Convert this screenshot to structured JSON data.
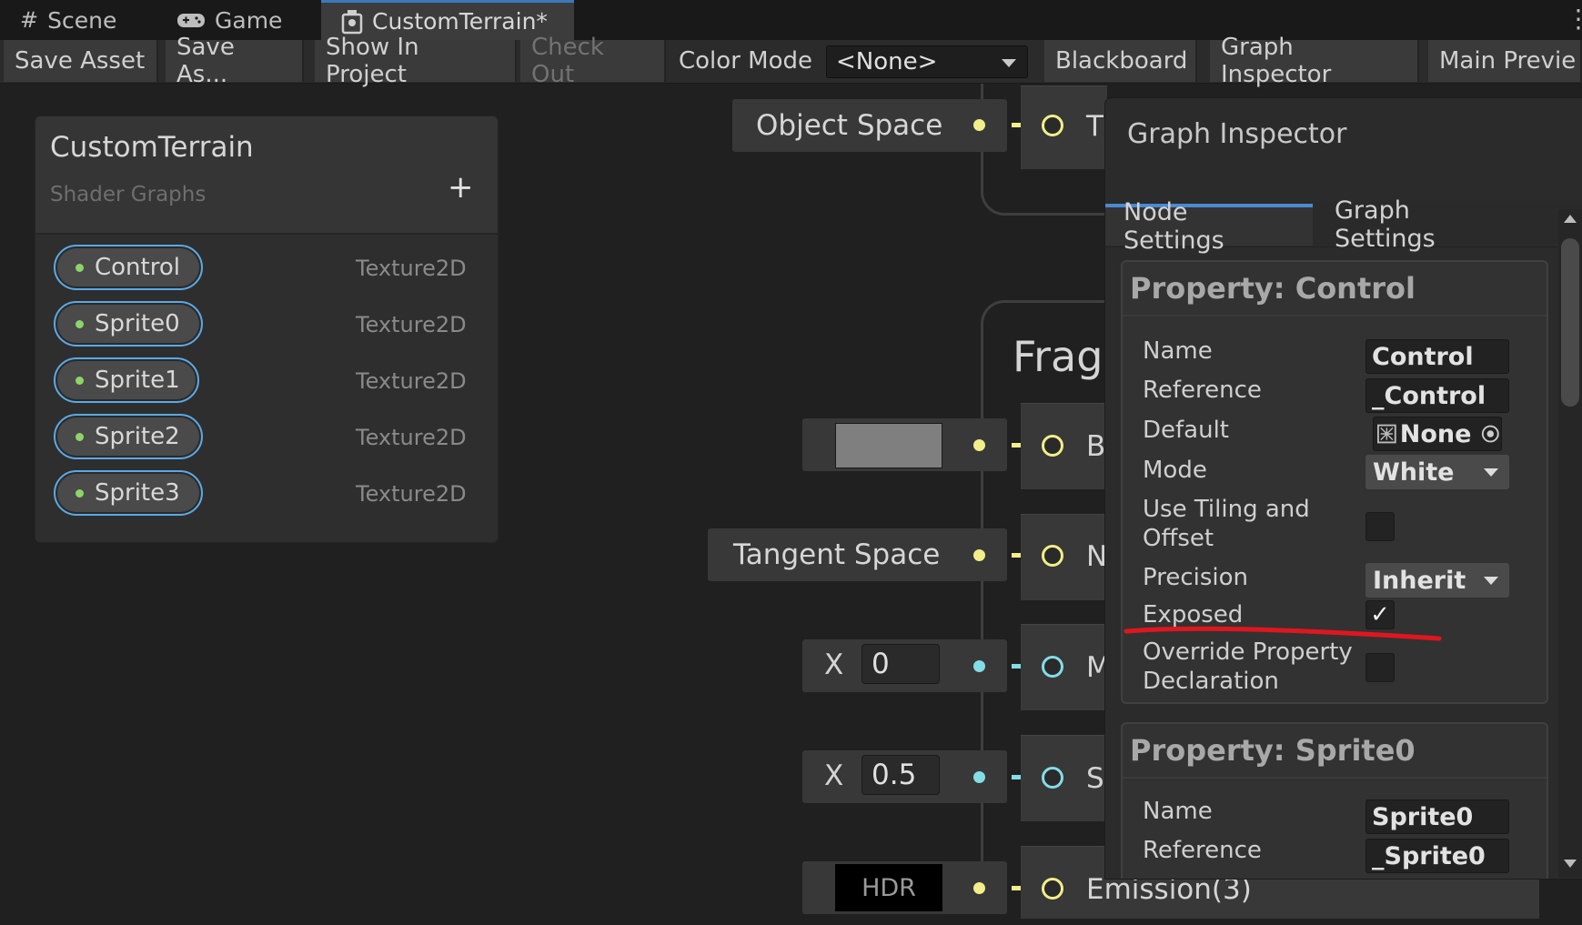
{
  "tabs": [
    {
      "label": "Scene",
      "icon": "grid-icon"
    },
    {
      "label": "Game",
      "icon": "gamepad-icon"
    },
    {
      "label": "CustomTerrain*",
      "icon": "shader-graph-icon"
    }
  ],
  "toolbar": {
    "save_asset": "Save Asset",
    "save_as": "Save As...",
    "show_in_project": "Show In Project",
    "check_out": "Check Out",
    "color_mode_label": "Color Mode",
    "color_mode_value": "<None>",
    "blackboard": "Blackboard",
    "graph_inspector": "Graph Inspector",
    "main_preview": "Main Previe"
  },
  "blackboard": {
    "title": "CustomTerrain",
    "subtitle": "Shader Graphs",
    "add_symbol": "+",
    "properties": [
      {
        "name": "Control",
        "type": "Texture2D"
      },
      {
        "name": "Sprite0",
        "type": "Texture2D"
      },
      {
        "name": "Sprite1",
        "type": "Texture2D"
      },
      {
        "name": "Sprite2",
        "type": "Texture2D"
      },
      {
        "name": "Sprite3",
        "type": "Texture2D"
      }
    ]
  },
  "graph": {
    "object_space": "Object Space",
    "tangent_space": "Tangent Space",
    "fragment_title": "Frag",
    "hdr": "HDR",
    "x_label": "X",
    "metallic_value": "0",
    "smoothness_value": "0.5",
    "letters": [
      "T",
      "B",
      "N",
      "M",
      "S"
    ],
    "emission_label": "Emission(3)",
    "colors": {
      "yellow_port": "#f2ee8a",
      "cyan_port": "#84dde6",
      "color_swatch": "#7f7f7f"
    }
  },
  "inspector": {
    "title": "Graph Inspector",
    "tabs": [
      "Node Settings",
      "Graph Settings"
    ],
    "section1": {
      "title": "Property: Control",
      "name_label": "Name",
      "name_value": "Control",
      "reference_label": "Reference",
      "reference_value": "_Control",
      "default_label": "Default",
      "default_value": "None",
      "mode_label": "Mode",
      "mode_value": "White",
      "tiling_label": "Use Tiling and Offset",
      "tiling_checked": false,
      "precision_label": "Precision",
      "precision_value": "Inherit",
      "exposed_label": "Exposed",
      "exposed_checked": true,
      "check_mark": "✓",
      "override_label": "Override Property Declaration",
      "override_checked": false
    },
    "section2": {
      "title": "Property: Sprite0",
      "name_label": "Name",
      "name_value": "Sprite0",
      "reference_label": "Reference",
      "reference_value": "_Sprite0"
    }
  },
  "annotation": {
    "color": "#e0161f"
  }
}
